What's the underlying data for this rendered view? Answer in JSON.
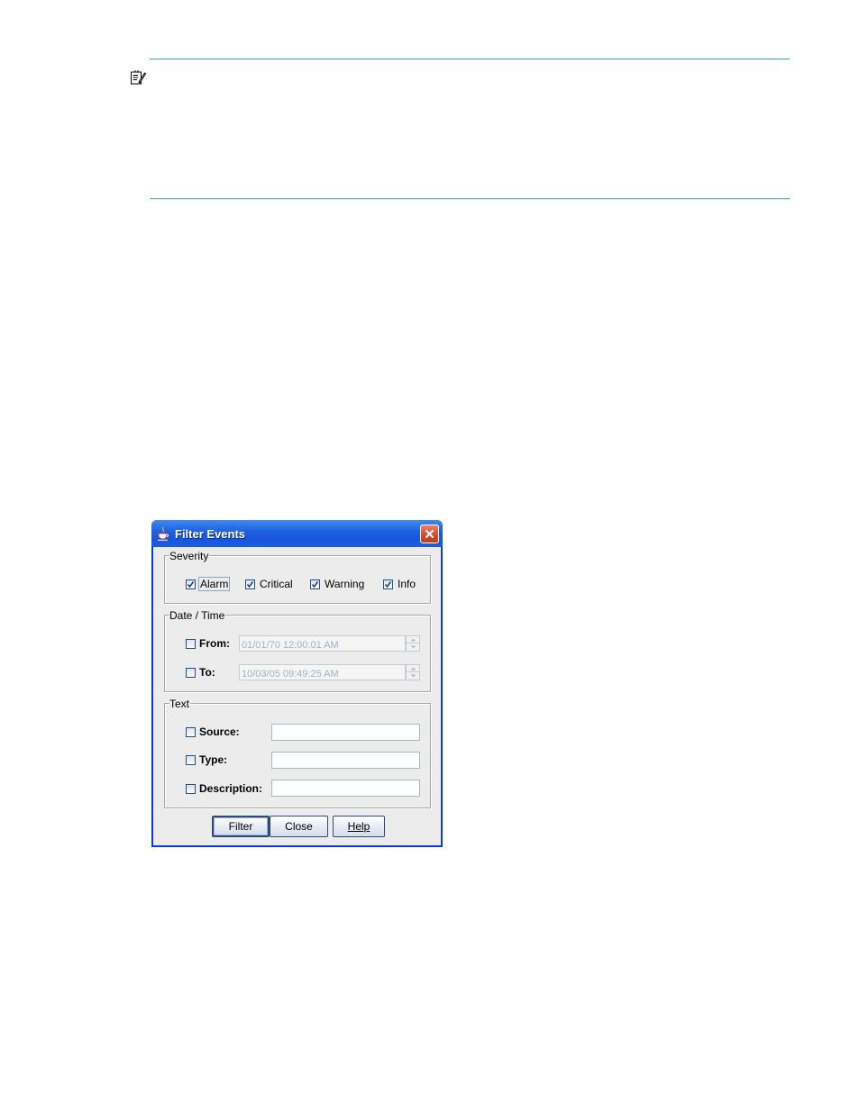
{
  "dialog": {
    "title": "Filter Events",
    "severity": {
      "legend": "Severity",
      "options": [
        {
          "label": "Alarm",
          "checked": true
        },
        {
          "label": "Critical",
          "checked": true
        },
        {
          "label": "Warning",
          "checked": true
        },
        {
          "label": "Info",
          "checked": true
        }
      ]
    },
    "datetime": {
      "legend": "Date / Time",
      "from_label": "From:",
      "from_value": "01/01/70 12:00:01 AM",
      "to_label": "To:",
      "to_value": "10/03/05 09:49:25 AM"
    },
    "text": {
      "legend": "Text",
      "source_label": "Source:",
      "source_value": "",
      "type_label": "Type:",
      "type_value": "",
      "description_label": "Description:",
      "description_value": ""
    },
    "buttons": {
      "filter": "Filter",
      "close": "Close",
      "help": "Help"
    }
  },
  "colors": {
    "rule": "#3fa3b8",
    "titlebar": "#1f63e0",
    "close_button": "#d1492b"
  },
  "icons": [
    "note-icon",
    "java-cup-icon",
    "close-icon",
    "checkmark-icon",
    "spinner-up-icon",
    "spinner-down-icon"
  ]
}
